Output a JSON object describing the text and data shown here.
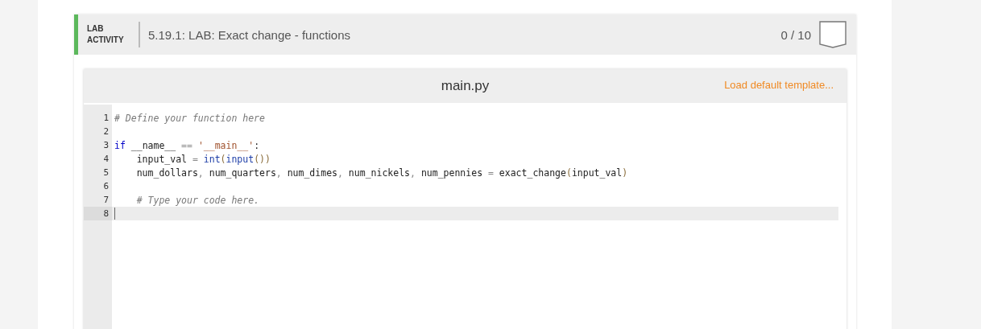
{
  "activity": {
    "type_label": "LAB\nACTIVITY",
    "title": "5.19.1: LAB: Exact change - functions",
    "score": "0 / 10"
  },
  "editor": {
    "file_name": "main.py",
    "template_link": "Load default template...",
    "lines": [
      {
        "number": "1",
        "active": false,
        "tokens": [
          {
            "kind": "comment",
            "text": "# Define your function here"
          }
        ]
      },
      {
        "number": "2",
        "active": false
      },
      {
        "number": "3",
        "active": false,
        "tokens": [
          {
            "kind": "keyword",
            "text": "if"
          },
          {
            "kind": "plain",
            "text": " __name__ "
          },
          {
            "kind": "operator",
            "text": "=="
          },
          {
            "kind": "string",
            "text": " '__main__'"
          },
          {
            "kind": "plain",
            "text": ":"
          }
        ]
      },
      {
        "number": "4",
        "active": false,
        "tokens": [
          {
            "kind": "plain",
            "text": "    input_val "
          },
          {
            "kind": "operator",
            "text": "= "
          },
          {
            "kind": "builtin",
            "text": "int"
          },
          {
            "kind": "paren",
            "text": "("
          },
          {
            "kind": "builtin",
            "text": "input"
          },
          {
            "kind": "paren",
            "text": "())"
          }
        ]
      },
      {
        "number": "5",
        "active": false,
        "tokens": [
          {
            "kind": "plain",
            "text": "    num_dollars"
          },
          {
            "kind": "operator",
            "text": ","
          },
          {
            "kind": "plain",
            "text": " num_quarters"
          },
          {
            "kind": "operator",
            "text": ","
          },
          {
            "kind": "plain",
            "text": " num_dimes"
          },
          {
            "kind": "operator",
            "text": ","
          },
          {
            "kind": "plain",
            "text": " num_nickels"
          },
          {
            "kind": "operator",
            "text": ","
          },
          {
            "kind": "plain",
            "text": " num_pennies "
          },
          {
            "kind": "operator",
            "text": "="
          },
          {
            "kind": "plain",
            "text": " exact_change"
          },
          {
            "kind": "paren",
            "text": "("
          },
          {
            "kind": "plain",
            "text": "input_val"
          },
          {
            "kind": "paren",
            "text": ")"
          }
        ]
      },
      {
        "number": "6",
        "active": false
      },
      {
        "number": "7",
        "active": false,
        "tokens": [
          {
            "kind": "comment",
            "text": "    # Type your code here."
          }
        ]
      },
      {
        "number": "8",
        "active": true
      }
    ]
  }
}
